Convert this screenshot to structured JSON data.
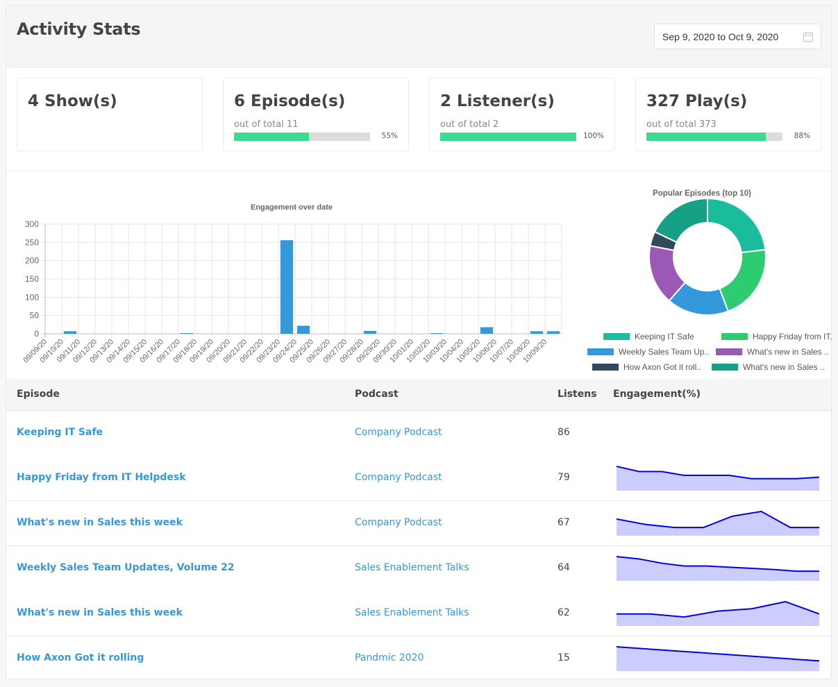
{
  "header": {
    "title": "Activity Stats",
    "date_range": "Sep 9, 2020 to Oct 9, 2020",
    "calendar_icon": "calendar-icon"
  },
  "stats": [
    {
      "label": "4 Show(s)",
      "sub": "",
      "percent": null,
      "percent_label": ""
    },
    {
      "label": "6 Episode(s)",
      "sub": "out of total 11",
      "percent": 55,
      "percent_label": "55%"
    },
    {
      "label": "2 Listener(s)",
      "sub": "out of total 2",
      "percent": 100,
      "percent_label": "100%"
    },
    {
      "label": "327 Play(s)",
      "sub": "out of total 373",
      "percent": 88,
      "percent_label": "88%"
    }
  ],
  "colors": {
    "accent": "#3498db",
    "progress": "#3ddb92",
    "progress_track": "#dcdcdc",
    "bar": "#3498db",
    "spark_line": "#0000e6",
    "spark_fill": "#ccccff"
  },
  "chart_data": [
    {
      "type": "bar",
      "title": "Engagement over date",
      "xlabel": "",
      "ylabel": "",
      "ylim": [
        0,
        300
      ],
      "yticks": [
        0,
        50,
        100,
        150,
        200,
        250,
        300
      ],
      "grid": true,
      "categories": [
        "09/09/20",
        "09/10/20",
        "09/11/20",
        "09/12/20",
        "09/13/20",
        "09/14/20",
        "09/15/20",
        "09/16/20",
        "09/17/20",
        "09/18/20",
        "09/19/20",
        "09/20/20",
        "09/21/20",
        "09/22/20",
        "09/23/20",
        "09/24/20",
        "09/25/20",
        "09/26/20",
        "09/27/20",
        "09/28/20",
        "09/29/20",
        "09/30/20",
        "10/01/20",
        "10/02/20",
        "10/03/20",
        "10/04/20",
        "10/05/20",
        "10/06/20",
        "10/07/20",
        "10/08/20",
        "10/09/20"
      ],
      "values": [
        0,
        7,
        0,
        0,
        0,
        0,
        0,
        0,
        1,
        0,
        0,
        0,
        0,
        0,
        256,
        22,
        0,
        0,
        0,
        8,
        0,
        0,
        0,
        1,
        0,
        0,
        18,
        0,
        0,
        7,
        7
      ],
      "color": "#3498db"
    },
    {
      "type": "pie",
      "title": "Popular Episodes (top 10)",
      "donut": true,
      "legend_position": "bottom",
      "labels": [
        "Keeping IT Safe",
        "Happy Friday from IT..",
        "Weekly Sales Team Up..",
        "What's new in Sales ..",
        "How Axon Got it roll..",
        "What's new in Sales .."
      ],
      "values": [
        86,
        79,
        64,
        62,
        15,
        67
      ],
      "colors": [
        "#1abc9c",
        "#2ecc71",
        "#3498db",
        "#9b59b6",
        "#34495e",
        "#16a085"
      ]
    }
  ],
  "table": {
    "headers": {
      "episode": "Episode",
      "podcast": "Podcast",
      "listens": "Listens",
      "engagement": "Engagement(%)"
    },
    "rows": [
      {
        "episode": "Keeping IT Safe",
        "podcast": "Company Podcast",
        "listens": "86",
        "engagement": []
      },
      {
        "episode": "Happy Friday from IT Helpdesk",
        "podcast": "Company Podcast",
        "listens": "79",
        "engagement": [
          100,
          78,
          78,
          62,
          62,
          62,
          48,
          48,
          48,
          54
        ]
      },
      {
        "episode": "What's new in Sales this week",
        "podcast": "Company Podcast",
        "listens": "67",
        "engagement": [
          68,
          45,
          32,
          32,
          80,
          100,
          32,
          32
        ]
      },
      {
        "episode": "Weekly Sales Team Updates, Volume 22",
        "podcast": "Sales Enablement Talks",
        "listens": "64",
        "engagement": [
          100,
          90,
          72,
          60,
          60,
          55,
          50,
          45,
          38,
          38
        ]
      },
      {
        "episode": "What's new in Sales this week",
        "podcast": "Sales Enablement Talks",
        "listens": "62",
        "engagement": [
          48,
          48,
          35,
          60,
          70,
          100,
          48
        ]
      },
      {
        "episode": "How Axon Got it rolling",
        "podcast": "Pandmic 2020",
        "listens": "15",
        "engagement": [
          100,
          90,
          80,
          70,
          60,
          50,
          40
        ]
      }
    ]
  }
}
